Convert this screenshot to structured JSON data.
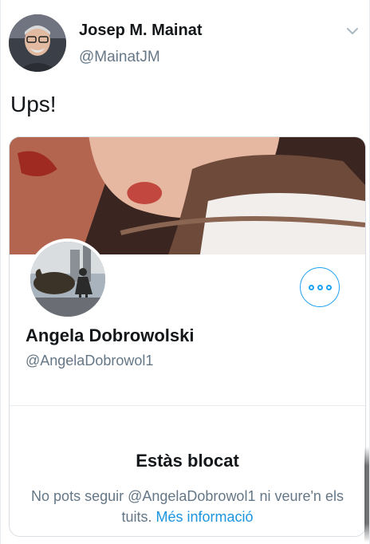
{
  "tweet": {
    "author": {
      "name": "Josep M. Mainat",
      "handle": "@MainatJM"
    },
    "text": "Ups!"
  },
  "card": {
    "profile": {
      "name": "Angela Dobrowolski",
      "handle": "@AngelaDobrowol1"
    },
    "blocked": {
      "title": "Estàs blocat",
      "description": "No pots seguir @AngelaDobrowol1 ni veure'n els tuits.",
      "link": "Més informació"
    }
  },
  "colors": {
    "accent": "#1da1f2",
    "secondary_text": "#657786",
    "primary_text": "#14171a"
  }
}
